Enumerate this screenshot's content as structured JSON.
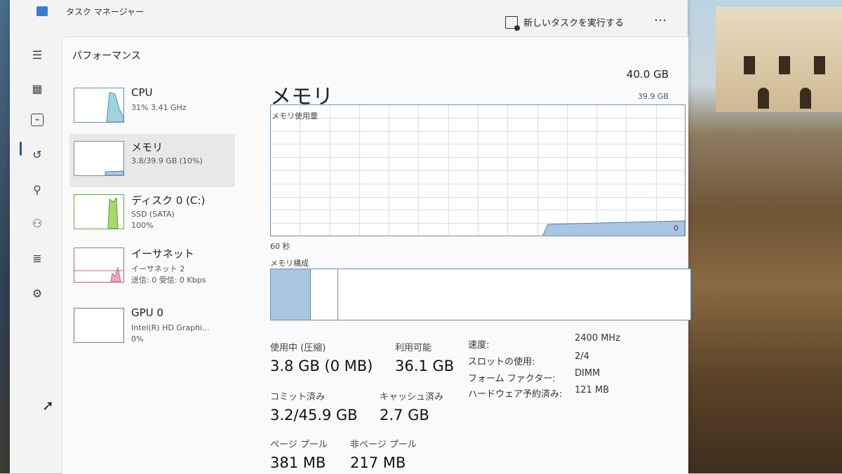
{
  "window": {
    "title": "タスク マネージャー",
    "run_task": "新しいタスクを実行する",
    "more": "…"
  },
  "section": "パフォーマンス",
  "devices": [
    {
      "name": "CPU",
      "sub1": "31%  3.41 GHz",
      "sub2": ""
    },
    {
      "name": "メモリ",
      "sub1": "3.8/39.9 GB (10%)",
      "sub2": ""
    },
    {
      "name": "ディスク 0 (C:)",
      "sub1": "SSD (SATA)",
      "sub2": "100%"
    },
    {
      "name": "イーサネット",
      "sub1": "イーサネット 2",
      "sub2": "送信: 0 受信: 0 Kbps"
    },
    {
      "name": "GPU 0",
      "sub1": "Intel(R) HD Graphi...",
      "sub2": "0%"
    }
  ],
  "memory": {
    "title": "メモリ",
    "total": "40.0 GB",
    "max_label": "39.9 GB",
    "usage_label": "メモリ使用量",
    "zero_label": "0",
    "time_label": "60 秒",
    "composition_label": "メモリ構成",
    "stats": {
      "in_use_label": "使用中 (圧縮)",
      "in_use": "3.8 GB (0 MB)",
      "available_label": "利用可能",
      "available": "36.1 GB",
      "committed_label": "コミット済み",
      "committed": "3.2/45.9 GB",
      "cached_label": "キャッシュ済み",
      "cached": "2.7 GB",
      "paged_label": "ページ プール",
      "paged": "381 MB",
      "nonpaged_label": "非ページ プール",
      "nonpaged": "217 MB"
    },
    "details": {
      "speed_label": "速度:",
      "speed": "2400 MHz",
      "slots_label": "スロットの使用:",
      "slots": "2/4",
      "form_label": "フォーム ファクター:",
      "form": "DIMM",
      "reserved_label": "ハードウェア予約済み:",
      "reserved": "121 MB"
    }
  }
}
